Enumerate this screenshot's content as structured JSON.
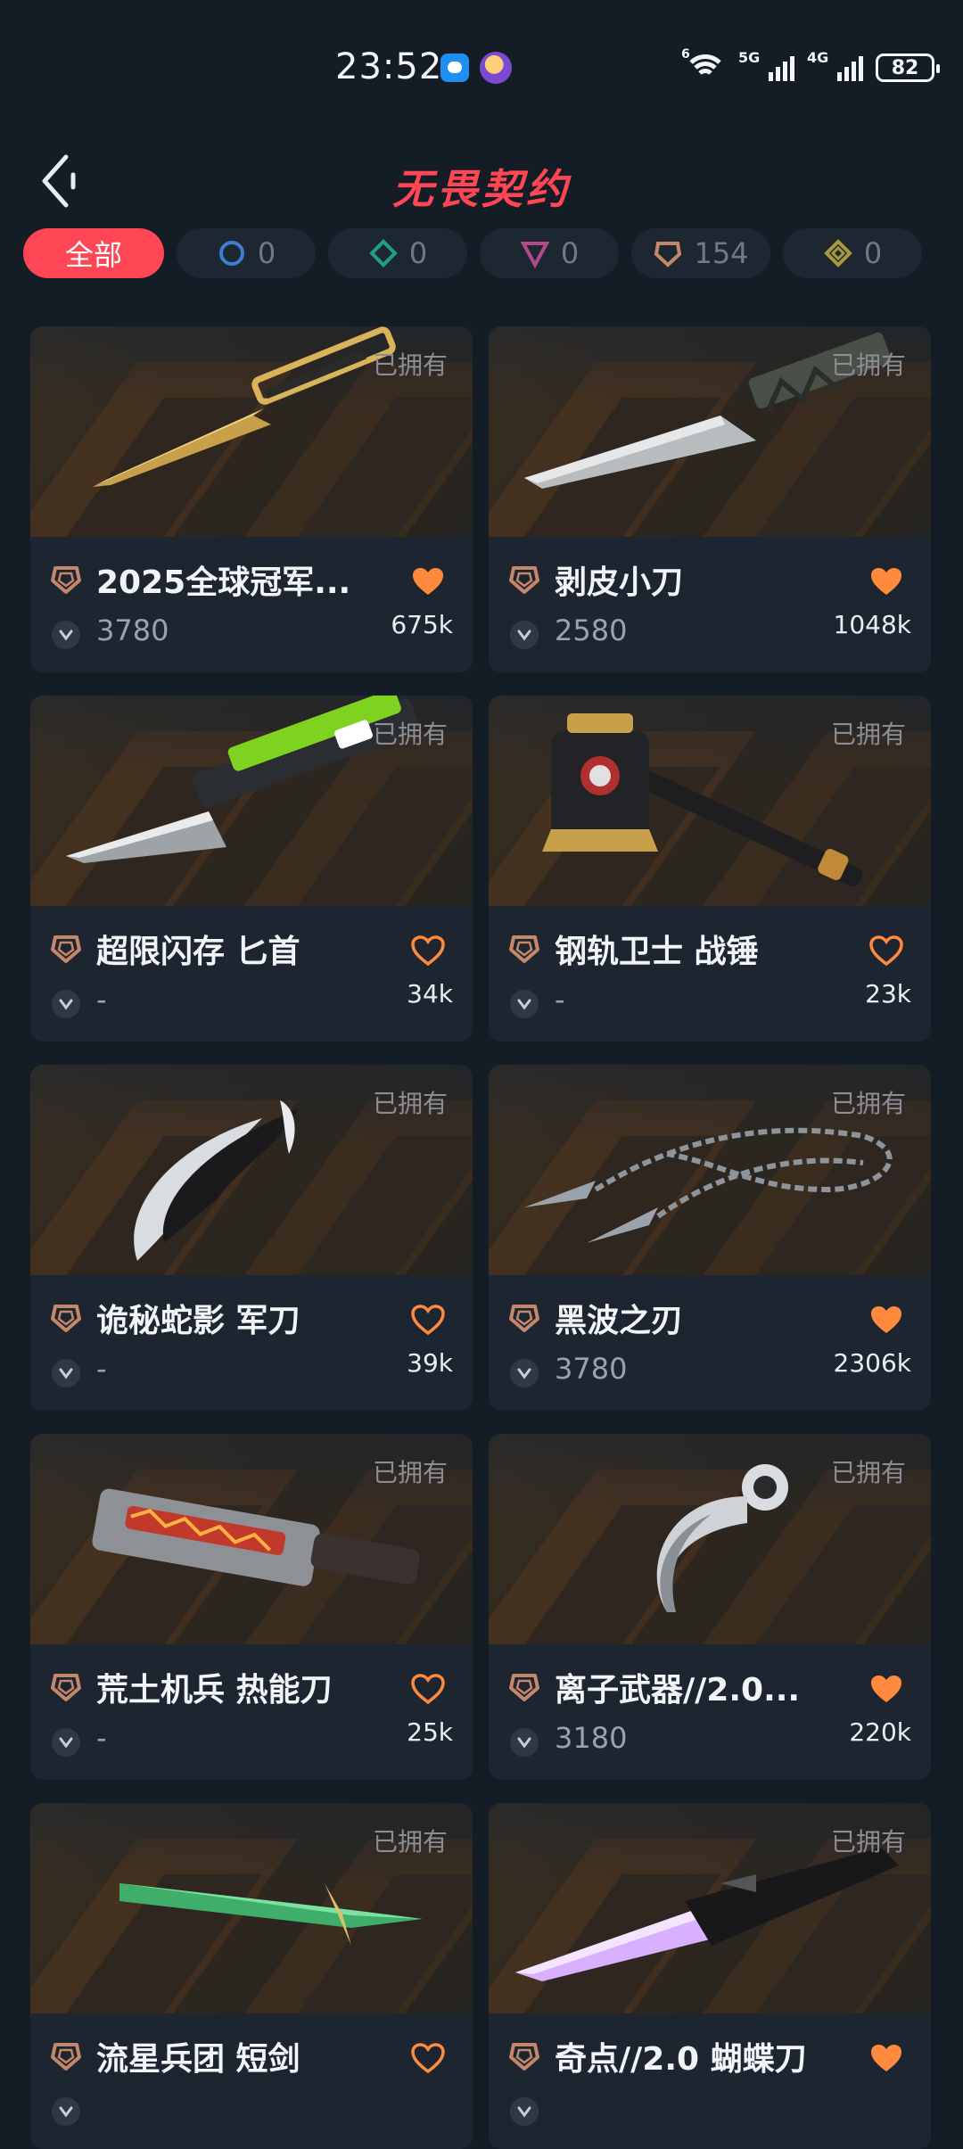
{
  "status": {
    "time": "23:52",
    "net1": "6",
    "net2": "5G",
    "net3": "4G",
    "battery": "82"
  },
  "header": {
    "title": "无畏契约",
    "back_icon": "chevron-left-icon"
  },
  "filters": [
    {
      "label": "全部",
      "active": true
    },
    {
      "count": "0",
      "icon": "tier-select-icon",
      "color": "#3b7fd0"
    },
    {
      "count": "0",
      "icon": "tier-deluxe-icon",
      "color": "#1f9e86"
    },
    {
      "count": "0",
      "icon": "tier-premium-icon",
      "color": "#b04a8a"
    },
    {
      "count": "154",
      "icon": "tier-exclusive-icon",
      "color": "#c4876a"
    },
    {
      "count": "0",
      "icon": "tier-ultra-icon",
      "color": "#a89a3a"
    }
  ],
  "owned_label": "已拥有",
  "colors": {
    "accent": "#ff4654",
    "heart": "#ff8a3d",
    "tier": "#c4876a"
  },
  "items": [
    {
      "name": "2025全球冠军...",
      "price": "3780",
      "likes": "675k",
      "favorited": true,
      "weapon": "gold-knife"
    },
    {
      "name": "剥皮小刀",
      "price": "2580",
      "likes": "1048k",
      "favorited": true,
      "weapon": "skinning-knife"
    },
    {
      "name": "超限闪存 匕首",
      "price": "-",
      "likes": "34k",
      "favorited": false,
      "weapon": "green-dagger"
    },
    {
      "name": "钢轨卫士 战锤",
      "price": "-",
      "likes": "23k",
      "favorited": false,
      "weapon": "war-hammer"
    },
    {
      "name": "诡秘蛇影 军刀",
      "price": "-",
      "likes": "39k",
      "favorited": false,
      "weapon": "serpent-blades"
    },
    {
      "name": "黑波之刃",
      "price": "3780",
      "likes": "2306k",
      "favorited": true,
      "weapon": "chain-kunai"
    },
    {
      "name": "荒土机兵 热能刀",
      "price": "-",
      "likes": "25k",
      "favorited": false,
      "weapon": "thermal-blade"
    },
    {
      "name": "离子武器//2.0...",
      "price": "3180",
      "likes": "220k",
      "favorited": true,
      "weapon": "karambit"
    },
    {
      "name": "流星兵团 短剑",
      "price": "",
      "likes": "",
      "favorited": false,
      "weapon": "green-sword"
    },
    {
      "name": "奇点//2.0 蝴蝶刀",
      "price": "",
      "likes": "",
      "favorited": true,
      "weapon": "butterfly-knife"
    }
  ]
}
